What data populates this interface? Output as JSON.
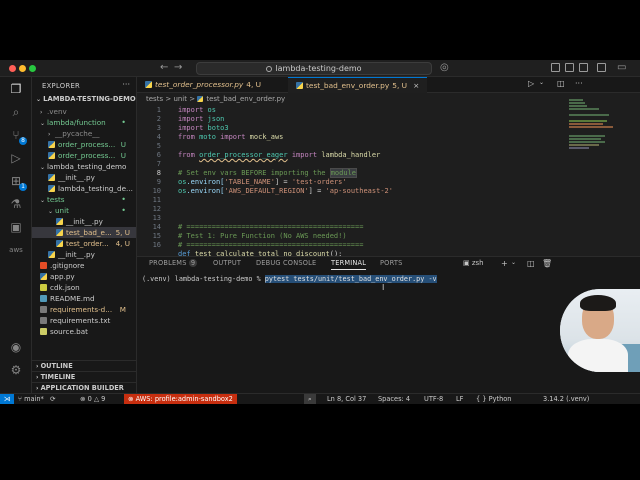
{
  "titlebar": {
    "search_text": "lambda-testing-demo"
  },
  "sidebar": {
    "header": "EXPLORER",
    "root": "LAMBDA-TESTING-DEMO",
    "items": [
      {
        "label": ".venv",
        "status": ""
      },
      {
        "label": "lambda/function",
        "status": "•"
      },
      {
        "label": "__pycache__",
        "status": ""
      },
      {
        "label": "order_process...",
        "status": "U"
      },
      {
        "label": "order_process...",
        "status": "U"
      },
      {
        "label": "lambda_testing_demo",
        "status": ""
      },
      {
        "label": "__init__.py",
        "status": ""
      },
      {
        "label": "lambda_testing_de...",
        "status": ""
      },
      {
        "label": "tests",
        "status": "•"
      },
      {
        "label": "unit",
        "status": "•"
      },
      {
        "label": "__init__.py",
        "status": ""
      },
      {
        "label": "test_bad_e...",
        "status": "5, U"
      },
      {
        "label": "test_order...",
        "status": "4, U"
      },
      {
        "label": "__init__.py",
        "status": ""
      },
      {
        "label": ".gitignore",
        "status": ""
      },
      {
        "label": "app.py",
        "status": ""
      },
      {
        "label": "cdk.json",
        "status": ""
      },
      {
        "label": "README.md",
        "status": ""
      },
      {
        "label": "requirements-d...",
        "status": "M"
      },
      {
        "label": "requirements.txt",
        "status": ""
      },
      {
        "label": "source.bat",
        "status": ""
      }
    ],
    "sections": [
      "OUTLINE",
      "TIMELINE",
      "APPLICATION BUILDER"
    ]
  },
  "tabs": [
    {
      "name": "test_order_processor.py",
      "badge": "4, U"
    },
    {
      "name": "test_bad_env_order.py",
      "badge": "5, U"
    }
  ],
  "breadcrumb": {
    "parts": [
      "tests",
      "unit",
      "test_bad_env_order.py"
    ],
    "sep": ">"
  },
  "code": {
    "line_numbers": [
      "1",
      "2",
      "3",
      "4",
      "5",
      "6",
      "7",
      "8",
      "9",
      "10",
      "11",
      "12",
      "13",
      "14",
      "15",
      "16"
    ],
    "l1_kw": "import",
    "l1_mod": "os",
    "l2_kw": "import",
    "l2_mod": "json",
    "l3_kw": "import",
    "l3_mod": "boto3",
    "l4_kw": "from",
    "l4_mod": "moto",
    "l4_kw2": "import",
    "l4_fn": "mock_aws",
    "l6_kw": "from",
    "l6_mod": "order_processor_eager",
    "l6_kw2": "import",
    "l6_fn": "lambda_handler",
    "l8_comment": "# Set env vars BEFORE importing the ",
    "l8_hl": "module",
    "l9_a": "os",
    "l9_b": ".environ[",
    "l9_key": "'TABLE_NAME'",
    "l9_eq": "] = ",
    "l9_val": "'test-orders'",
    "l10_a": "os",
    "l10_b": ".environ[",
    "l10_key": "'AWS_DEFAULT_REGION'",
    "l10_eq": "] = ",
    "l10_val": "'ap-southeast-2'",
    "l14_comment": "# ==========================================",
    "l15_comment": "# Test 1: Pure Function (No AWS needed!)",
    "l16_comment": "# ==========================================",
    "l17_kw": "def",
    "l17_fn": "test_calculate_total_no_discount",
    "l17_rest": "():"
  },
  "panel": {
    "tabs": [
      "PROBLEMS",
      "OUTPUT",
      "DEBUG CONSOLE",
      "TERMINAL",
      "PORTS"
    ],
    "problems_count": "9",
    "terminal_name": "zsh",
    "prompt": "(.venv) lambda-testing-demo % ",
    "command": "pytest tests/unit/test_bad_env_order.py -v"
  },
  "status": {
    "branch": "main*",
    "sync": "⟳",
    "errors": "0",
    "warnings": "9",
    "aws": "AWS: profile:admin-sandbox2",
    "position": "Ln 8, Col 37",
    "spaces": "Spaces: 4",
    "encoding": "UTF-8",
    "eol": "LF",
    "language": "Python",
    "interpreter": "3.14.2 (.venv)"
  },
  "colors": {
    "accent": "#0078d4",
    "aws_badge": "#c72e0f",
    "untracked": "#73c991",
    "modified": "#e2c08d"
  }
}
